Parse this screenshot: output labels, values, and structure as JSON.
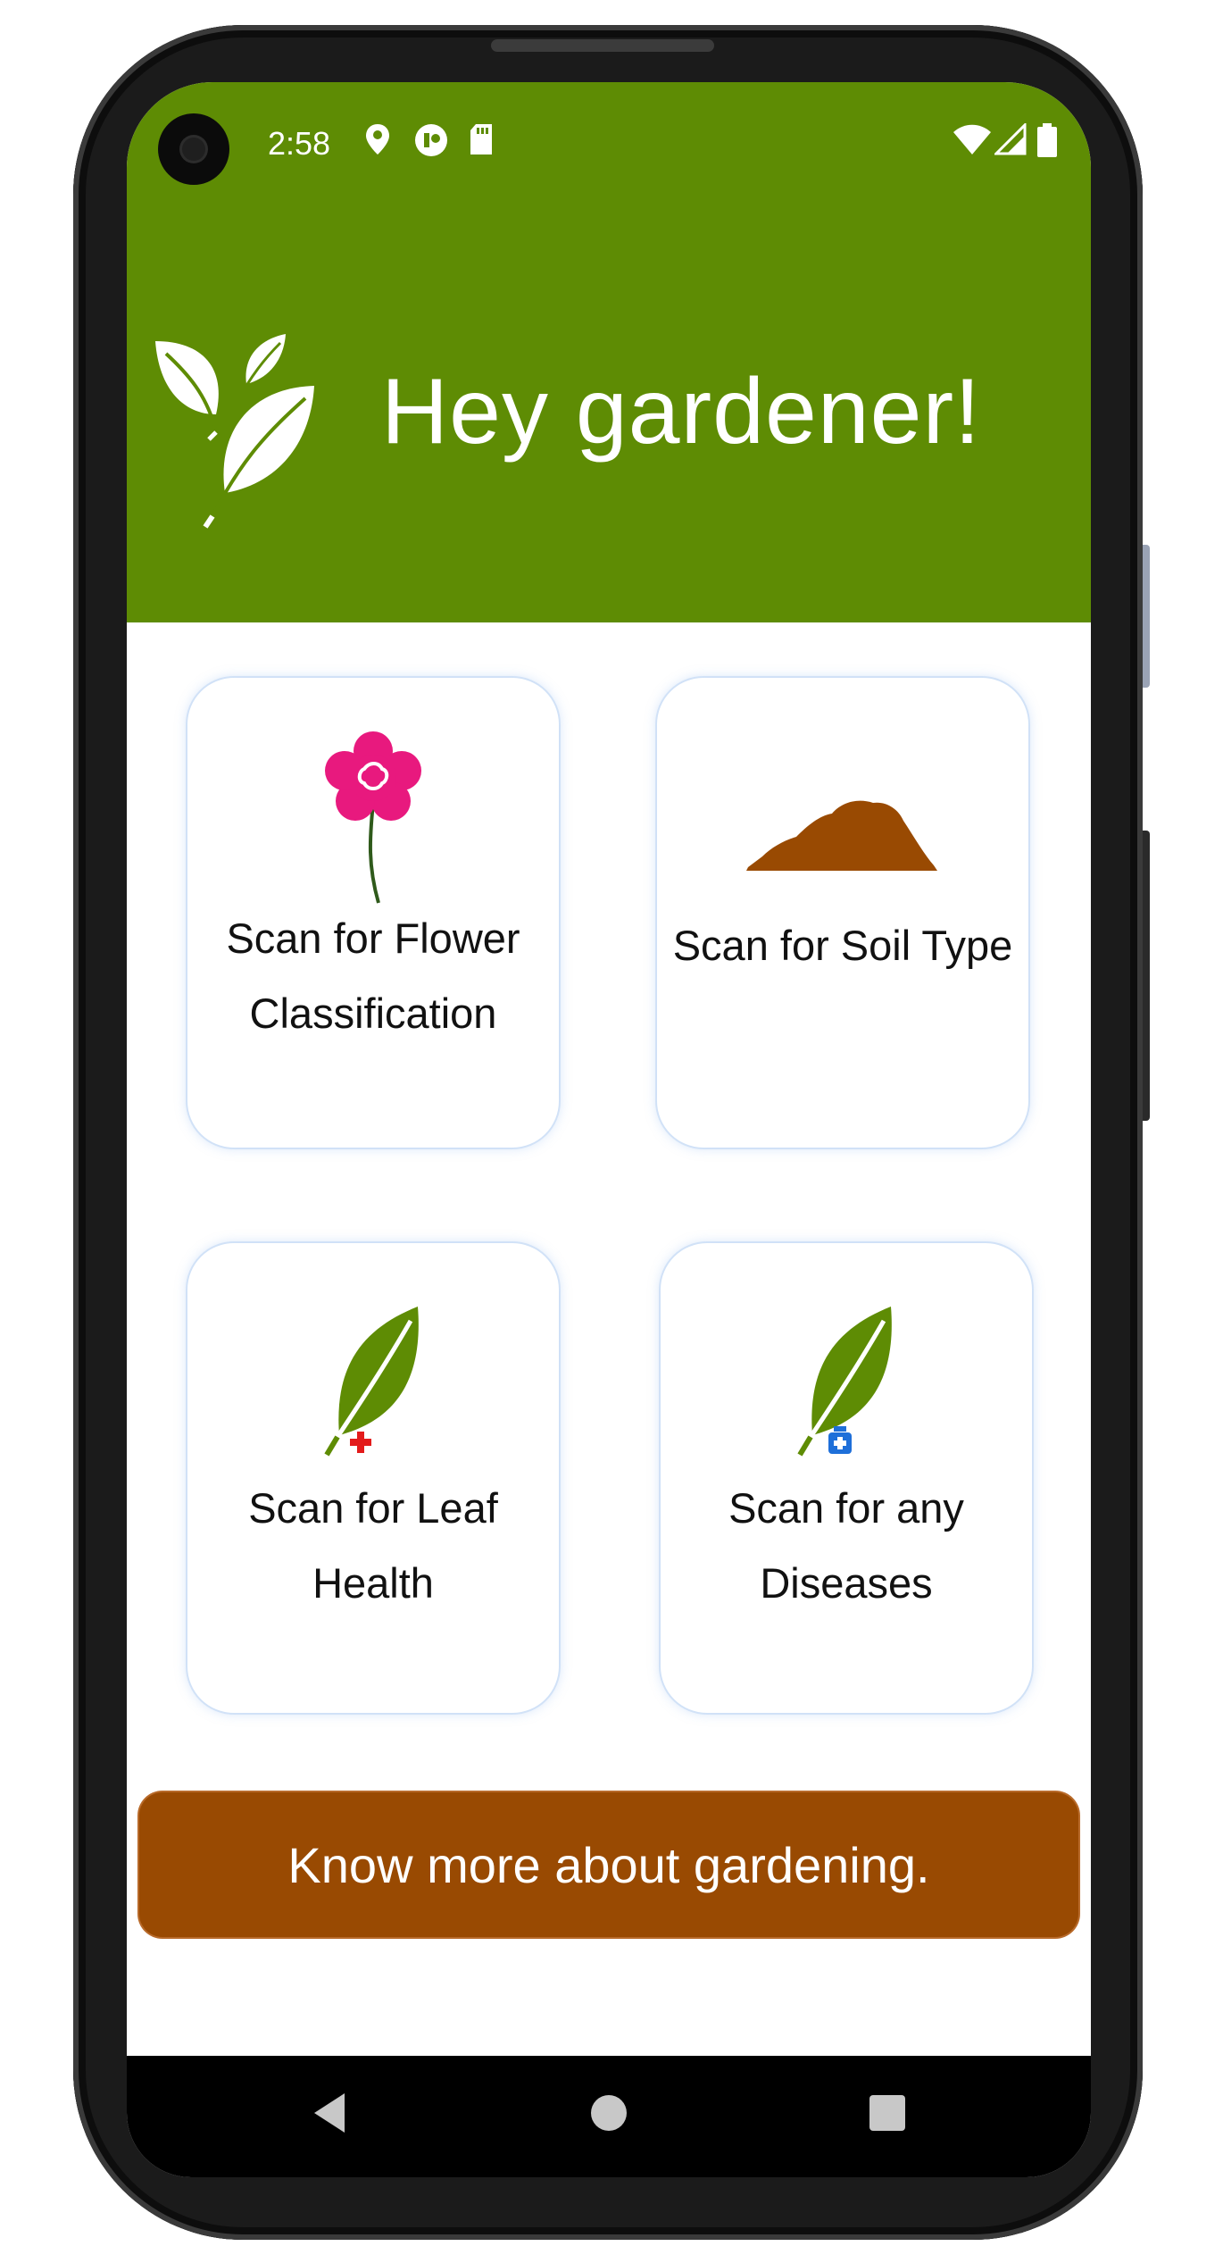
{
  "status_bar": {
    "time": "2:58",
    "icons": [
      "location-icon",
      "app-status-icon",
      "sd-card-icon",
      "wifi-icon",
      "signal-icon",
      "battery-icon"
    ]
  },
  "header": {
    "greeting": "Hey gardener!",
    "logo_icon": "leaves-logo-icon",
    "background_color": "#5e8c04"
  },
  "cards": [
    {
      "label": "Scan for Flower Classification",
      "icon": "flower-icon"
    },
    {
      "label": "Scan for Soil Type",
      "icon": "soil-icon"
    },
    {
      "label": "Scan for Leaf Health",
      "icon": "leaf-health-icon"
    },
    {
      "label": "Scan for any Diseases",
      "icon": "leaf-disease-icon"
    }
  ],
  "cta": {
    "label": "Know more about gardening.",
    "color": "#994a02"
  },
  "nav": {
    "back": "back-icon",
    "home": "home-icon",
    "recents": "recents-icon"
  }
}
